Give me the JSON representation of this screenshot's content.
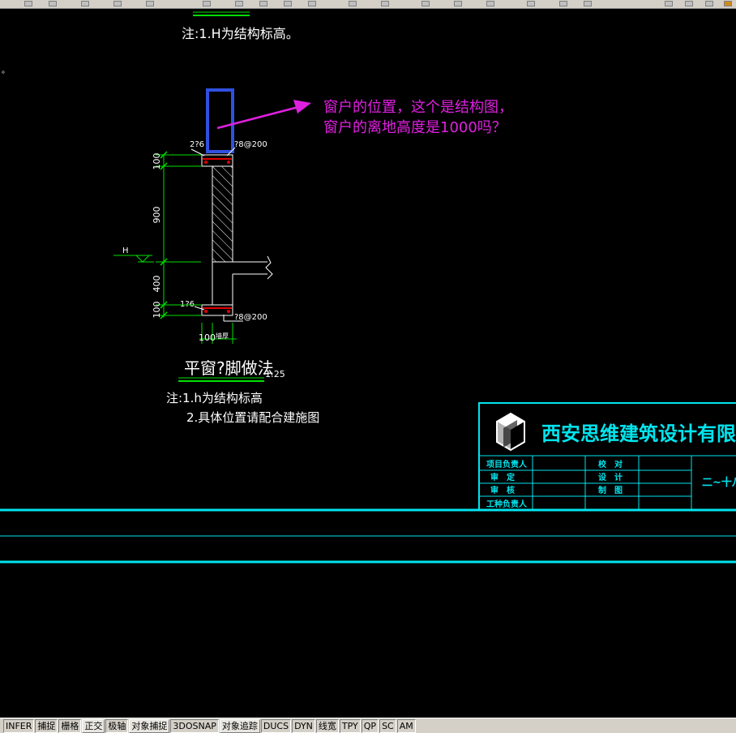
{
  "notes": {
    "top_note": "注:1.H为结构标高。",
    "stray_mark": "。",
    "note1": "注:1.h为结构标高",
    "note2": "2.具体位置请配合建施图"
  },
  "annotation": {
    "line1": "窗户的位置，这个是结构图，",
    "line2": "窗户的离地高度是1000吗？",
    "color": "#e020e0"
  },
  "section": {
    "title": "平窗?脚做法",
    "scale": "1:25",
    "level_mark": "H",
    "rebar_top_left": "2?6",
    "rebar_top_right": "?8@200",
    "rebar_bottom_left": "1?6",
    "rebar_bottom_right": "?8@200",
    "dims_vertical": [
      "100",
      "900",
      "400",
      "100"
    ],
    "dim_bottom": "100",
    "dim_bottom_right": "墙厚"
  },
  "title_block": {
    "company": "西安思维建筑设计有限责任公司",
    "rows_left": [
      "项目负责人",
      "审　定",
      "审　核",
      "工种负责人"
    ],
    "rows_mid": [
      "校　对",
      "设　计",
      "制　图"
    ],
    "right_text": "二~十八",
    "color": "#00e5ee"
  },
  "statusbar": {
    "items": [
      {
        "label": "INFER",
        "on": false
      },
      {
        "label": "捕捉",
        "on": false
      },
      {
        "label": "栅格",
        "on": false
      },
      {
        "label": "正交",
        "on": true
      },
      {
        "label": "极轴",
        "on": false
      },
      {
        "label": "对象捕捉",
        "on": true
      },
      {
        "label": "3DOSNAP",
        "on": false
      },
      {
        "label": "对象追踪",
        "on": true
      },
      {
        "label": "DUCS",
        "on": false
      },
      {
        "label": "DYN",
        "on": false
      },
      {
        "label": "线宽",
        "on": false
      },
      {
        "label": "TPY",
        "on": false
      },
      {
        "label": "QP",
        "on": false
      },
      {
        "label": "SC",
        "on": false
      },
      {
        "label": "AM",
        "on": false
      }
    ]
  }
}
